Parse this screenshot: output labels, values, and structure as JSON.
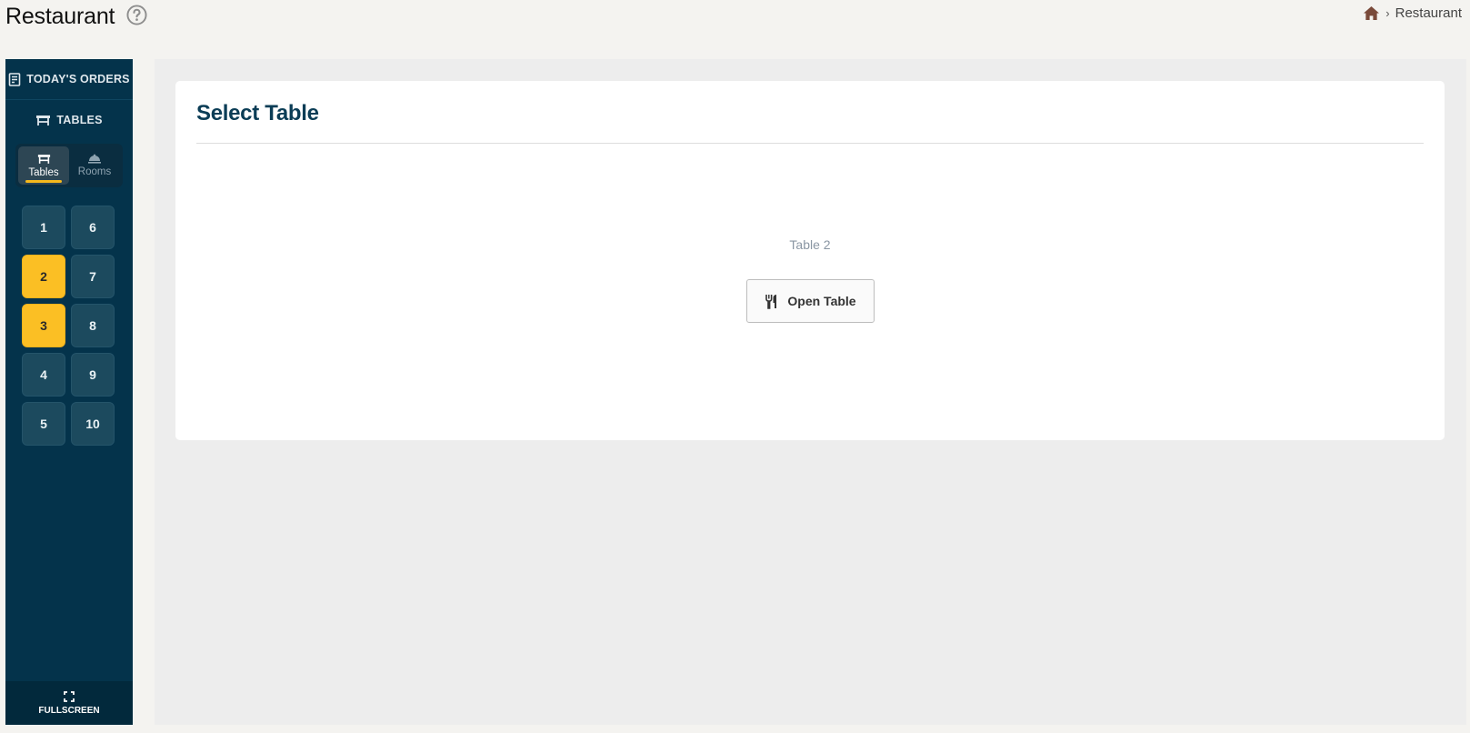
{
  "header": {
    "title": "Restaurant",
    "help_icon": "question-circle-icon",
    "breadcrumb": {
      "home_icon": "home-icon",
      "separator": "›",
      "current": "Restaurant"
    }
  },
  "sidebar": {
    "orders_label": "TODAY'S ORDERS",
    "tables_label": "TABLES",
    "segments": [
      {
        "label": "Tables",
        "icon": "table-icon",
        "active": true
      },
      {
        "label": "Rooms",
        "icon": "room-icon",
        "active": false
      }
    ],
    "tables": [
      {
        "label": "1",
        "occupied": false
      },
      {
        "label": "6",
        "occupied": false
      },
      {
        "label": "2",
        "occupied": true
      },
      {
        "label": "7",
        "occupied": false
      },
      {
        "label": "3",
        "occupied": true
      },
      {
        "label": "8",
        "occupied": false
      },
      {
        "label": "4",
        "occupied": false
      },
      {
        "label": "9",
        "occupied": false
      },
      {
        "label": "5",
        "occupied": false
      },
      {
        "label": "10",
        "occupied": false
      }
    ],
    "fullscreen_label": "FULLSCREEN"
  },
  "main": {
    "card_title": "Select Table",
    "selected_table": "Table 2",
    "open_button_label": "Open Table"
  },
  "colors": {
    "sidebar_bg": "#04334b",
    "accent": "#fbbf24",
    "title": "#0b3d56"
  }
}
